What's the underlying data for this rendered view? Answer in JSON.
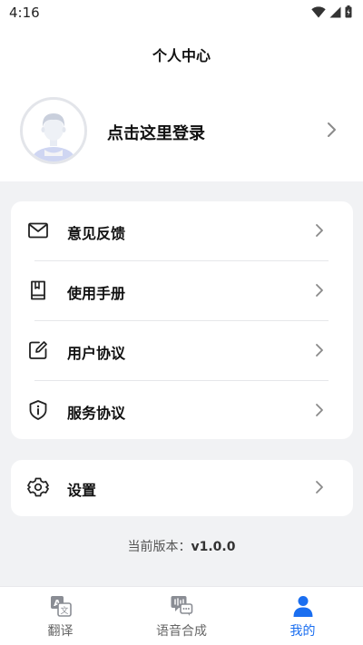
{
  "status_bar": {
    "time": "4:16"
  },
  "header": {
    "title": "个人中心"
  },
  "profile": {
    "login_label": "点击这里登录"
  },
  "menu": {
    "items": [
      {
        "label": "意见反馈",
        "icon": "mail-icon"
      },
      {
        "label": "使用手册",
        "icon": "book-icon"
      },
      {
        "label": "用户协议",
        "icon": "edit-icon"
      },
      {
        "label": "服务协议",
        "icon": "info-icon"
      }
    ]
  },
  "settings": {
    "label": "设置",
    "icon": "gear-icon"
  },
  "version": {
    "label": "当前版本：",
    "value": "v1.0.0"
  },
  "bottom_nav": {
    "items": [
      {
        "label": "翻译",
        "icon": "translate-icon"
      },
      {
        "label": "语音合成",
        "icon": "voice-synthesis-icon"
      },
      {
        "label": "我的",
        "icon": "user-icon",
        "active": true
      }
    ]
  },
  "colors": {
    "accent": "#1a6ef0",
    "background": "#f1f2f4",
    "card": "#ffffff"
  }
}
